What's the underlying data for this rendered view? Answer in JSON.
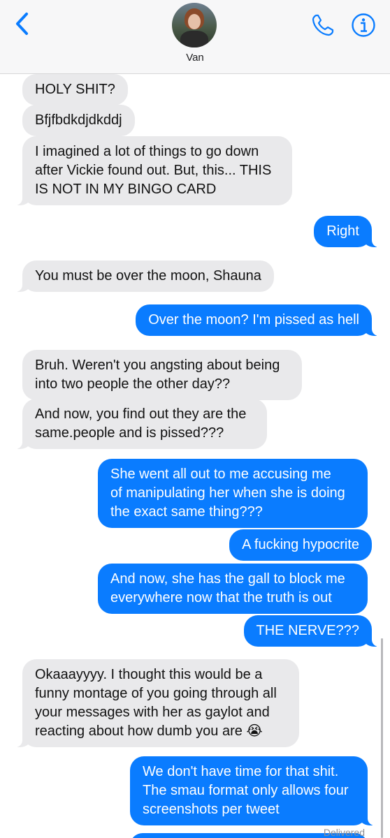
{
  "header": {
    "contact_name": "Van",
    "back_icon": "chevron-left-icon",
    "phone_icon": "phone-icon",
    "info_icon": "info-icon",
    "accent_color": "#0a7cff"
  },
  "messages": [
    {
      "direction": "incoming",
      "text": "HOLY SHIT?"
    },
    {
      "direction": "incoming",
      "text": "Bfjfbdkdjdkddj"
    },
    {
      "direction": "incoming",
      "text": "I imagined a lot of things to go down\nafter Vickie found out. But, this... THIS\nIS NOT IN MY BINGO CARD"
    },
    {
      "direction": "outgoing",
      "text": "Right"
    },
    {
      "direction": "incoming",
      "text": "You must be over the moon, Shauna"
    },
    {
      "direction": "outgoing",
      "text": "Over the moon? I'm pissed as hell"
    },
    {
      "direction": "incoming",
      "text": "Bruh. Weren't you angsting about being\ninto two people the other day??"
    },
    {
      "direction": "incoming",
      "text": "And now, you find out they are the\nsame.people and is pissed???"
    },
    {
      "direction": "outgoing",
      "text": "She went all out to me accusing me\nof manipulating her when she is doing\nthe exact same thing???"
    },
    {
      "direction": "outgoing",
      "text": "A fucking hypocrite"
    },
    {
      "direction": "outgoing",
      "text": "And now, she has the gall to block me\neverywhere now that the truth is out"
    },
    {
      "direction": "outgoing",
      "text": "THE NERVE???"
    },
    {
      "direction": "incoming",
      "text": "Okaaayyyy. I thought this would be a\nfunny montage of you going through all\nyour messages with her as gaylot and\nreacting about how dumb you are 😭"
    },
    {
      "direction": "outgoing",
      "text": "We don't have time for that shit.\nThe smau format only allows four\nscreenshots per tweet"
    }
  ],
  "status": {
    "delivered": "Delivered"
  }
}
